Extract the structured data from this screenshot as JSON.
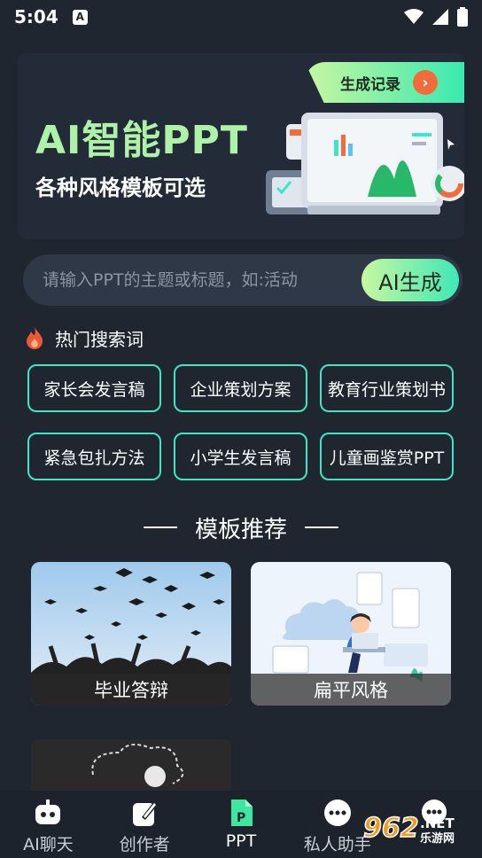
{
  "status_bar": {
    "time": "5:04",
    "a_badge": "A",
    "icons": [
      "wifi-icon",
      "signal-icon",
      "battery-icon"
    ]
  },
  "banner": {
    "title": "AI智能PPT",
    "subtitle": "各种风格模板可选",
    "record_label": "生成记录",
    "arrow": "›"
  },
  "search": {
    "placeholder": "请输入PPT的主题或标题，如:活动",
    "generate_label": "AI生成"
  },
  "hot": {
    "title": "热门搜索词",
    "terms": [
      "家长会发言稿",
      "企业策划方案",
      "教育行业策划书",
      "紧急包扎方法",
      "小学生发言稿",
      "儿童画鉴赏PPT"
    ]
  },
  "templates": {
    "section_title": "模板推荐",
    "items": [
      "毕业答辩",
      "扁平风格"
    ]
  },
  "nav": {
    "items": [
      "AI聊天",
      "创作者",
      "PPT",
      "私人助手",
      ""
    ],
    "active_index": 2
  },
  "watermark": {
    "number": "962",
    "suffix": ".NET",
    "sub": "乐游网"
  },
  "colors": {
    "background": "#1f2630",
    "accent_green": "#aef2a8",
    "chip_border": "#3ee6c8",
    "record_arrow": "#f26b3a"
  }
}
